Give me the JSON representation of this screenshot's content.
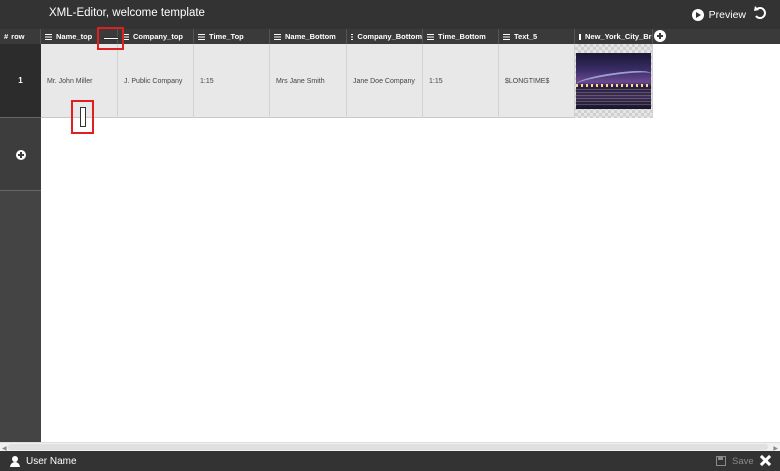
{
  "app": {
    "title": "XML-Editor, welcome template"
  },
  "toolbar": {
    "preview_label": "Preview"
  },
  "columns": [
    {
      "label": "row",
      "icon": "hash-icon"
    },
    {
      "label": "Name_top",
      "icon": "text-lines-icon"
    },
    {
      "label": "Company_top",
      "icon": "text-lines-icon"
    },
    {
      "label": "Time_Top",
      "icon": "text-lines-icon"
    },
    {
      "label": "Name_Bottom",
      "icon": "text-lines-icon"
    },
    {
      "label": "Company_Bottom",
      "icon": "text-lines-icon"
    },
    {
      "label": "Time_Bottom",
      "icon": "text-lines-icon"
    },
    {
      "label": "Text_5",
      "icon": "text-lines-icon"
    },
    {
      "label": "New_York_City_Bri",
      "icon": "image-icon"
    }
  ],
  "rows": [
    {
      "number": "1",
      "cells": [
        "Mr. John Miller",
        "J. Public Company",
        "1:15",
        "Mrs Jane Smith",
        "Jane Doe Company",
        "1:15",
        "$LONGTIME$"
      ],
      "image": "New York City bridge at night thumbnail"
    }
  ],
  "footer": {
    "user_name": "User Name",
    "save_label": "Save"
  },
  "colors": {
    "titlebar": "#333333",
    "header": "#3a3a3a",
    "gutter": "#444444",
    "row_bg": "#e8e8e8",
    "highlight": "#e02020"
  }
}
